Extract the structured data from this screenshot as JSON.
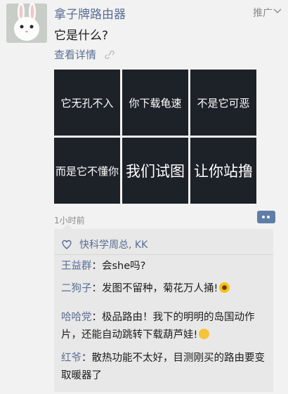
{
  "post": {
    "account_name": "拿子牌路由器",
    "ad_label": "推广",
    "text": "它是什么?",
    "detail_link": "查看详情",
    "tiles": [
      "它无孔不入",
      "你下载龟速",
      "不是它可恶",
      "而是它不懂你",
      "我们试图",
      "让你站撸"
    ],
    "time": "1小时前"
  },
  "panel": {
    "likes": "快科学周总, KK",
    "comments": [
      {
        "name": "王益群",
        "text": "：会she吗?"
      },
      {
        "name": "二狗子",
        "text": "：发图不留种，菊花万人捅!"
      },
      {
        "name": "哈哈党",
        "text": "：极品路由！我下的明明的岛国动作片，还能自动跳转下载葫芦娃!"
      },
      {
        "name": "红爷",
        "text": "：散热功能不太好，目测刚买的路由要变取暖器了"
      }
    ]
  },
  "colors": {
    "link": "#5a6e95",
    "tile_bg": "#1d2128",
    "panel_bg": "#e8e8e8",
    "more_button": "#5f7ea7"
  },
  "icons": [
    "rabbit-avatar",
    "chevron-down-icon",
    "link-icon",
    "more-icon",
    "heart-icon",
    "sunflower-emoji",
    "smile-emoji"
  ]
}
